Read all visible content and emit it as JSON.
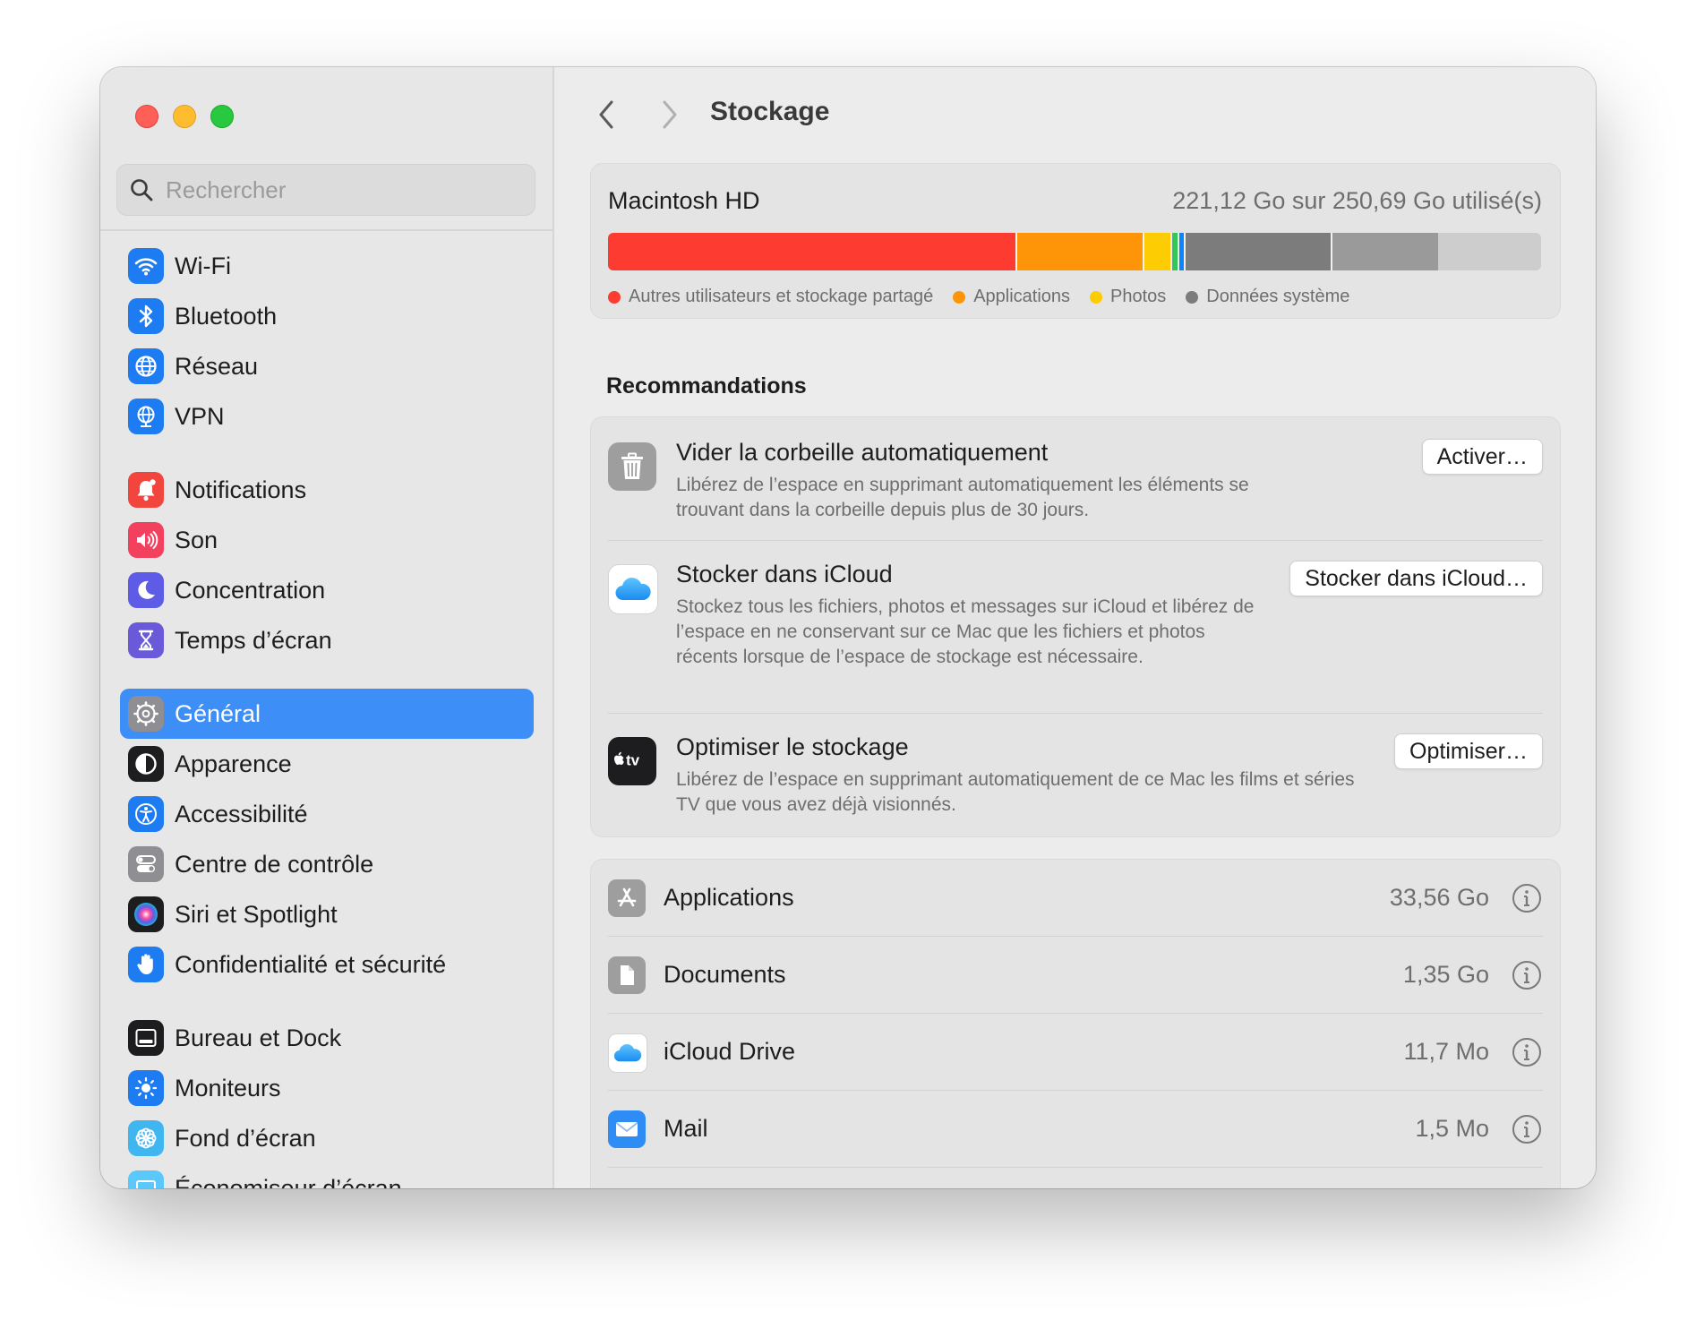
{
  "window": {
    "traffic_lights": [
      "close",
      "minimize",
      "zoom"
    ]
  },
  "sidebar": {
    "search_placeholder": "Rechercher",
    "groups": [
      [
        {
          "label": "Wi-Fi",
          "icon": "wifi-icon",
          "color": "#1e7cf2"
        },
        {
          "label": "Bluetooth",
          "icon": "bluetooth-icon",
          "color": "#1e7cf2"
        },
        {
          "label": "Réseau",
          "icon": "globe-icon",
          "color": "#1e7cf2"
        },
        {
          "label": "VPN",
          "icon": "vpn-globe-icon",
          "color": "#1e7cf2"
        }
      ],
      [
        {
          "label": "Notifications",
          "icon": "bell-icon",
          "color": "#f2453d"
        },
        {
          "label": "Son",
          "icon": "speaker-icon",
          "color": "#f2405e"
        },
        {
          "label": "Concentration",
          "icon": "moon-icon",
          "color": "#5e5ce6"
        },
        {
          "label": "Temps d’écran",
          "icon": "hourglass-icon",
          "color": "#6a5ad9"
        }
      ],
      [
        {
          "label": "Général",
          "icon": "gear-icon",
          "color": "#8e8e93",
          "selected": true
        },
        {
          "label": "Apparence",
          "icon": "appearance-icon",
          "color": "#1d1d1f"
        },
        {
          "label": "Accessibilité",
          "icon": "accessibility-icon",
          "color": "#1e7cf2"
        },
        {
          "label": "Centre de contrôle",
          "icon": "toggles-icon",
          "color": "#8e8e93"
        },
        {
          "label": "Siri et Spotlight",
          "icon": "siri-icon",
          "color": "#7a3ad6"
        },
        {
          "label": "Confidentialité et sécurité",
          "icon": "hand-icon",
          "color": "#1e7cf2"
        }
      ],
      [
        {
          "label": "Bureau et Dock",
          "icon": "dock-icon",
          "color": "#1d1d1f"
        },
        {
          "label": "Moniteurs",
          "icon": "sun-icon",
          "color": "#1e7cf2"
        },
        {
          "label": "Fond d’écran",
          "icon": "flower-icon",
          "color": "#3fb6f0"
        },
        {
          "label": "Économiseur d’écran",
          "icon": "screensaver-icon",
          "color": "#5ac8fa"
        }
      ]
    ]
  },
  "toolbar": {
    "back": "‹",
    "forward": "›",
    "title": "Stockage"
  },
  "disk": {
    "name": "Macintosh HD",
    "usage": "221,12 Go sur 250,69 Go utilisé(s)",
    "used_fraction": 0.882,
    "segments": [
      {
        "color": "#fd3b30",
        "fraction": 0.437
      },
      {
        "color": "#fe9408",
        "fraction": 0.134
      },
      {
        "color": "#fecc02",
        "fraction": 0.028
      },
      {
        "color": "#33c759",
        "fraction": 0.006
      },
      {
        "color": "#0a84ff",
        "fraction": 0.004
      },
      {
        "color": "#7c7c7c",
        "fraction": 0.156
      },
      {
        "color": "#9a9a9a",
        "fraction": 0.113
      }
    ],
    "legend": [
      {
        "label": "Autres utilisateurs et stockage partagé",
        "color": "#fd3b30"
      },
      {
        "label": "Applications",
        "color": "#fe9408"
      },
      {
        "label": "Photos",
        "color": "#fecc02"
      },
      {
        "label": "Données système",
        "color": "#7c7c7c"
      }
    ]
  },
  "recommendations": {
    "title": "Recommandations",
    "items": [
      {
        "title": "Vider la corbeille automatiquement",
        "description": "Libérez de l’espace en supprimant automatiquement les éléments se trouvant dans la corbeille depuis plus de 30 jours.",
        "button": "Activer…",
        "icon": "trash-icon"
      },
      {
        "title": "Stocker dans iCloud",
        "description": "Stockez tous les fichiers, photos et messages sur iCloud et libérez de l’espace en ne conservant sur ce Mac que les fichiers et photos récents lorsque de l’espace de stockage est nécessaire.",
        "button": "Stocker dans iCloud…",
        "icon": "icloud-icon"
      },
      {
        "title": "Optimiser le stockage",
        "description": "Libérez de l’espace en supprimant automatiquement de ce Mac les films et séries TV que vous avez déjà visionnés.",
        "button": "Optimiser…",
        "icon": "apple-tv-icon",
        "icon_text": "tv"
      }
    ]
  },
  "storage_items": [
    {
      "name": "Applications",
      "size": "33,56 Go",
      "icon": "app-store-icon"
    },
    {
      "name": "Documents",
      "size": "1,35 Go",
      "icon": "document-icon"
    },
    {
      "name": "iCloud Drive",
      "size": "11,7 Mo",
      "icon": "icloud-drive-icon"
    },
    {
      "name": "Mail",
      "size": "1,5 Mo",
      "icon": "mail-icon"
    }
  ]
}
